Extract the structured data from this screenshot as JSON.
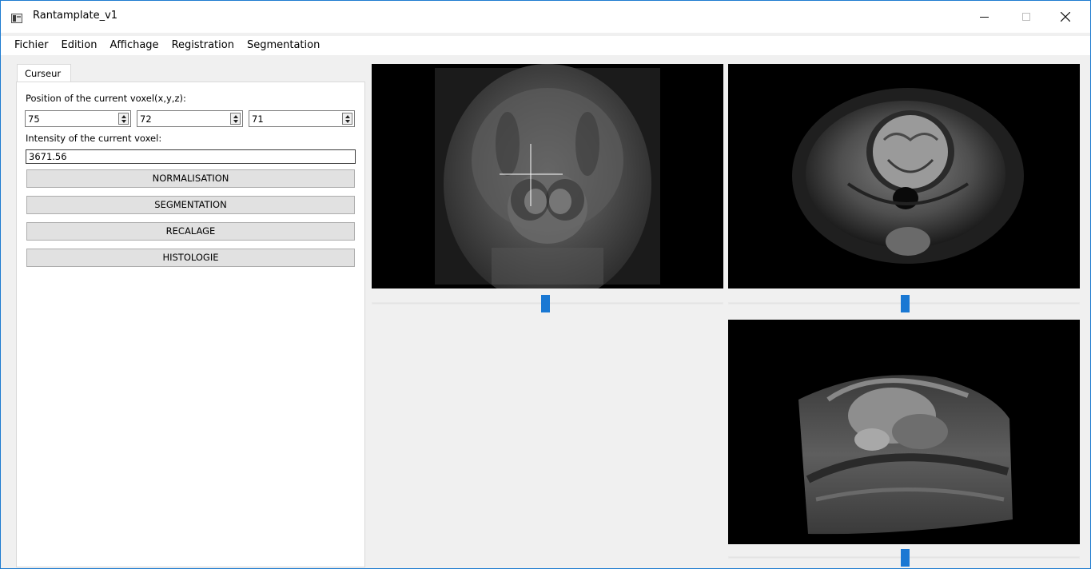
{
  "window": {
    "title": "Rantamplate_v1"
  },
  "menu": [
    "Fichier",
    "Edition",
    "Affichage",
    "Registration",
    "Segmentation"
  ],
  "cursor_panel": {
    "tab_label": "Curseur",
    "position_label": "Position of the current voxel(x,y,z):",
    "x": "75",
    "y": "72",
    "z": "71",
    "intensity_label": "Intensity of the current voxel:",
    "intensity_value": "3671.56",
    "buttons": {
      "normalisation": "NORMALISATION",
      "segmentation": "SEGMENTATION",
      "recalage": "RECALAGE",
      "histologie": "HISTOLOGIE"
    }
  },
  "sliders": {
    "axial": 0.5,
    "coronal": 0.5,
    "sagittal": 0.5
  },
  "colors": {
    "accent": "#1a78d3",
    "window_border": "#1e7bd0"
  }
}
